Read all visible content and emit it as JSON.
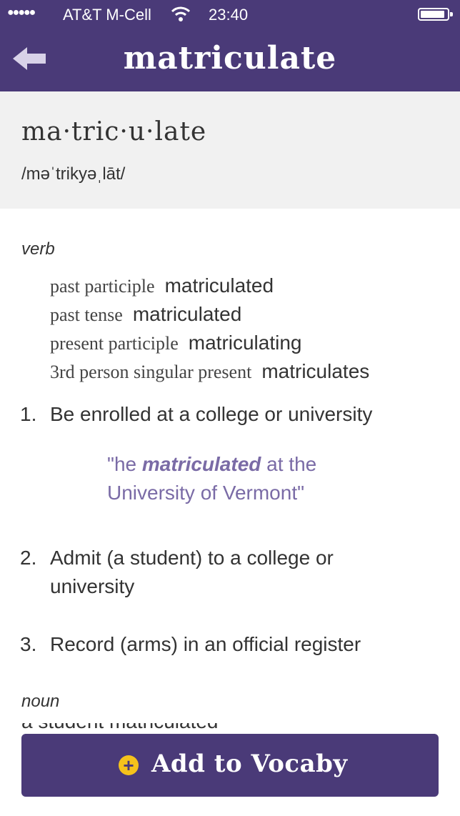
{
  "status_bar": {
    "signal": "●●●●●",
    "carrier": "AT&T M-Cell",
    "wifi_icon": "wifi-icon",
    "time": "23:40",
    "battery_icon": "battery-icon"
  },
  "header": {
    "title": "matriculate",
    "back_icon": "back-arrow-icon"
  },
  "entry": {
    "syllables": "ma·tric·u·late",
    "pronunciation": "/məˈtrikyəˌlāt/"
  },
  "verb": {
    "pos": "verb",
    "forms": [
      {
        "label": "past participle",
        "value": "matriculated"
      },
      {
        "label": "past tense",
        "value": "matriculated"
      },
      {
        "label": "present participle",
        "value": "matriculating"
      },
      {
        "label": "3rd person singular present",
        "value": "matriculates"
      }
    ],
    "definitions": [
      {
        "number": "1.",
        "text": "Be enrolled at a college or university"
      },
      {
        "number": "2.",
        "text": "Admit (a student) to a college or university"
      },
      {
        "number": "3.",
        "text": "Record (arms) in an official register"
      }
    ],
    "example": {
      "before": "\"he ",
      "emphasis": "matriculated",
      "after": " at the University of Vermont\""
    }
  },
  "noun": {
    "pos": "noun",
    "partial_text": "a student matriculated"
  },
  "cta": {
    "label": "Add to Vocaby",
    "icon": "plus-circle-icon",
    "icon_color": "#f5c21b"
  },
  "colors": {
    "brand": "#4a3a78",
    "example_text": "#7a6ba6",
    "word_box_bg": "#f1f1f1"
  }
}
